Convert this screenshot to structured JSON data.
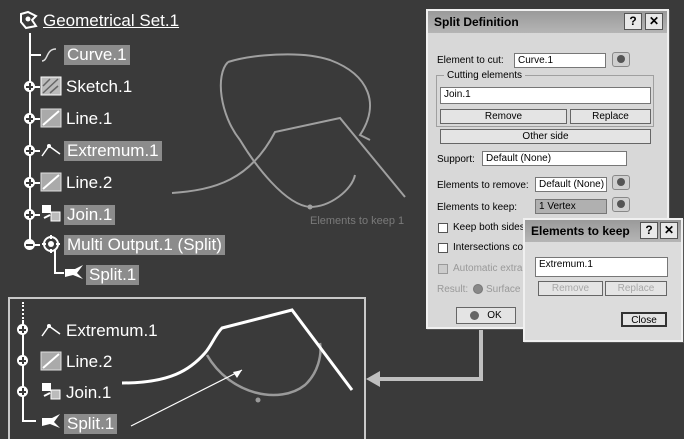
{
  "tree": {
    "root_label": "Geometrical Set.1",
    "items": [
      {
        "label": "Curve.1",
        "highlighted": true
      },
      {
        "label": "Sketch.1",
        "highlighted": false
      },
      {
        "label": "Line.1",
        "highlighted": false
      },
      {
        "label": "Extremum.1",
        "highlighted": true
      },
      {
        "label": "Line.2",
        "highlighted": false
      },
      {
        "label": "Join.1",
        "highlighted": true
      },
      {
        "label": "Multi Output.1 (Split)",
        "highlighted": true
      },
      {
        "label": "Split.1",
        "highlighted": true
      }
    ]
  },
  "viewport": {
    "label": "Elements to keep 1"
  },
  "inset_tree": {
    "items": [
      {
        "label": "Extremum.1"
      },
      {
        "label": "Line.2"
      },
      {
        "label": "Join.1"
      },
      {
        "label": "Split.1",
        "highlighted": true
      }
    ]
  },
  "split_dialog": {
    "title": "Split Definition",
    "help_btn": "?",
    "close_btn": "✕",
    "element_to_cut_label": "Element to cut:",
    "element_to_cut_value": "Curve.1",
    "cutting_group_label": "Cutting elements",
    "cutting_list": [
      "Join.1"
    ],
    "remove_btn": "Remove",
    "replace_btn": "Replace",
    "other_side_btn": "Other side",
    "support_label": "Support:",
    "support_value": "Default (None)",
    "to_remove_label": "Elements to remove:",
    "to_remove_value": "Default (None)",
    "to_keep_label": "Elements to keep:",
    "to_keep_value": "1 Vertex",
    "keep_both_label": "Keep both sides",
    "intersections_label": "Intersections co",
    "automatic_label": "Automatic extra",
    "result_label": "Result:",
    "surface_label": "Surface",
    "ok_btn": "OK"
  },
  "keep_dialog": {
    "title": "Elements to keep",
    "help_btn": "?",
    "close_btn": "✕",
    "list": [
      "Extremum.1"
    ],
    "remove_btn": "Remove",
    "replace_btn": "Replace",
    "close_label": "Close"
  },
  "colors": {
    "background": "#3a3a3a",
    "highlight": "#8c8c8c",
    "curve_gray": "#a0a0a0",
    "curve_white": "#ffffff",
    "dialog_bg": "#d8d8d8"
  }
}
